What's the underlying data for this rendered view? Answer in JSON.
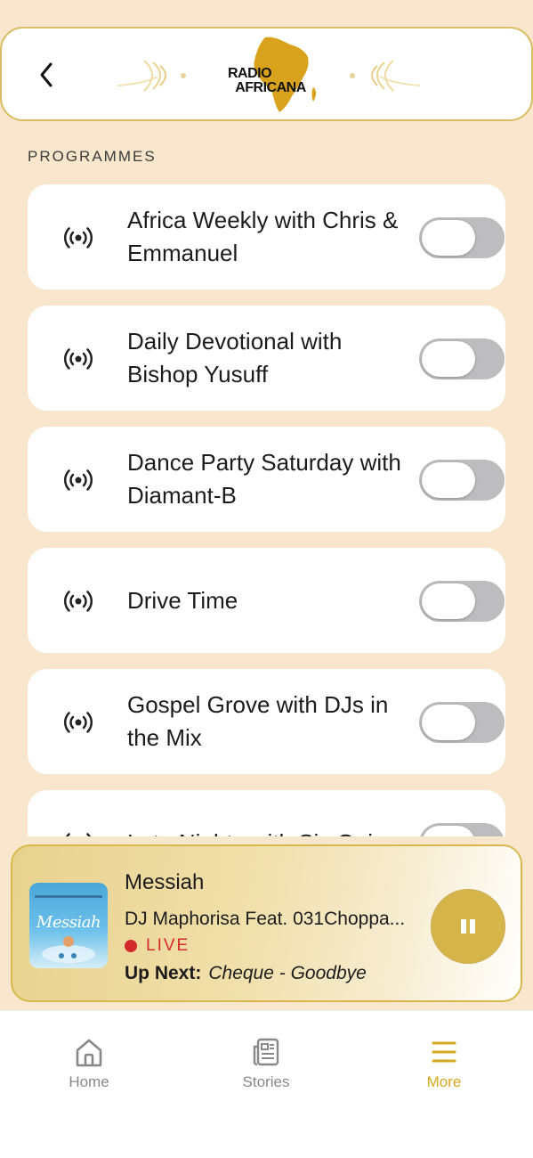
{
  "header": {
    "logo_line1": "RADIO",
    "logo_line2": "AFRICANA",
    "back_icon": "chevron-left-icon"
  },
  "section_title": "PROGRAMMES",
  "programmes": [
    {
      "title": "Africa Weekly with Chris & Emmanuel",
      "enabled": false
    },
    {
      "title": "Daily Devotional with Bishop Yusuff",
      "enabled": false
    },
    {
      "title": "Dance Party Saturday with Diamant-B",
      "enabled": false
    },
    {
      "title": "Drive Time",
      "enabled": false
    },
    {
      "title": "Gospel Grove with DJs in the Mix",
      "enabled": false
    },
    {
      "title": "Late Nights with Sis Ogie",
      "enabled": false
    }
  ],
  "now_playing": {
    "title": "Messiah",
    "artist": "DJ Maphorisa Feat. 031Choppa...",
    "status": "LIVE",
    "up_next_label": "Up Next:",
    "up_next_value": "Cheque - Goodbye",
    "art_text": "Messiah",
    "pause_icon": "pause-icon"
  },
  "tabs": [
    {
      "label": "Home",
      "icon": "home-icon",
      "active": false
    },
    {
      "label": "Stories",
      "icon": "newspaper-icon",
      "active": false
    },
    {
      "label": "More",
      "icon": "menu-icon",
      "active": true
    }
  ],
  "colors": {
    "background": "#f8e6cd",
    "accent_gold": "#d5b44a",
    "live_red": "#d32b2b",
    "toggle_off": "#bdbdbf"
  }
}
